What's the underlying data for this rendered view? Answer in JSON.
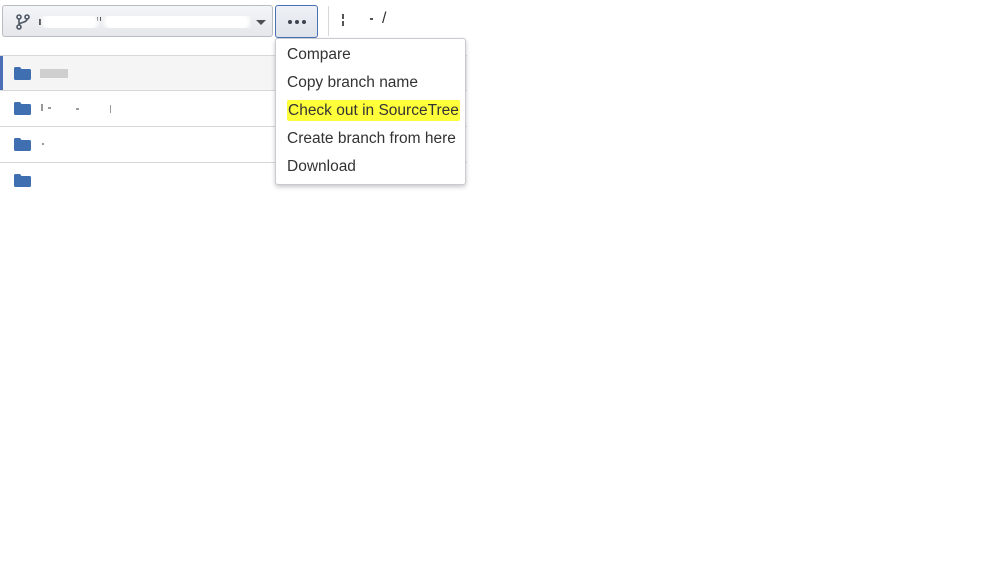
{
  "toolbar": {
    "branch_icon": "git-branch-icon",
    "caret_icon": "caret-down-icon",
    "more_icon": "ellipsis-icon",
    "breadcrumb_separator": "/"
  },
  "menu": {
    "items": [
      {
        "label": "Compare",
        "highlighted": false
      },
      {
        "label": "Copy branch name",
        "highlighted": false
      },
      {
        "label": "Check out in SourceTree",
        "highlighted": true
      },
      {
        "label": "Create branch from here",
        "highlighted": false
      },
      {
        "label": "Download",
        "highlighted": false
      }
    ],
    "highlight_color": "#ffff3a"
  },
  "file_list": {
    "folder_icon": "folder-icon",
    "folder_color": "#3f6fb0",
    "row_count": 4
  },
  "colors": {
    "accent": "#4a6fb5",
    "text": "#333333"
  }
}
